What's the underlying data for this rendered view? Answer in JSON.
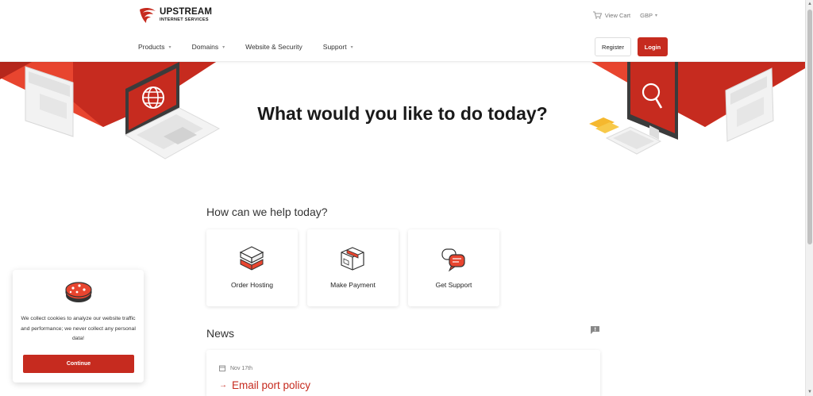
{
  "brand": {
    "name": "UPSTREAM",
    "tagline": "INTERNET SERVICES"
  },
  "topbar": {
    "cart_label": "View Cart",
    "currency": "GBP"
  },
  "nav": {
    "items": [
      {
        "label": "Products",
        "dropdown": true
      },
      {
        "label": "Domains",
        "dropdown": true
      },
      {
        "label": "Website & Security",
        "dropdown": false
      },
      {
        "label": "Support",
        "dropdown": true
      }
    ],
    "register_label": "Register",
    "login_label": "Login"
  },
  "hero": {
    "title": "What would you like to do today?"
  },
  "help": {
    "title": "How can we help today?",
    "cards": [
      {
        "label": "Order Hosting",
        "icon": "server-box-icon"
      },
      {
        "label": "Make Payment",
        "icon": "package-icon"
      },
      {
        "label": "Get Support",
        "icon": "chat-bubbles-icon"
      }
    ]
  },
  "news": {
    "title": "News",
    "items": [
      {
        "date": "Nov 17th",
        "headline": "Email port policy"
      }
    ]
  },
  "cookie": {
    "text": "We collect cookies to analyze our website traffic and performance; we never collect any personal data!",
    "button_label": "Continue"
  },
  "colors": {
    "accent": "#c62b1f",
    "accent_light": "#e8452f"
  }
}
